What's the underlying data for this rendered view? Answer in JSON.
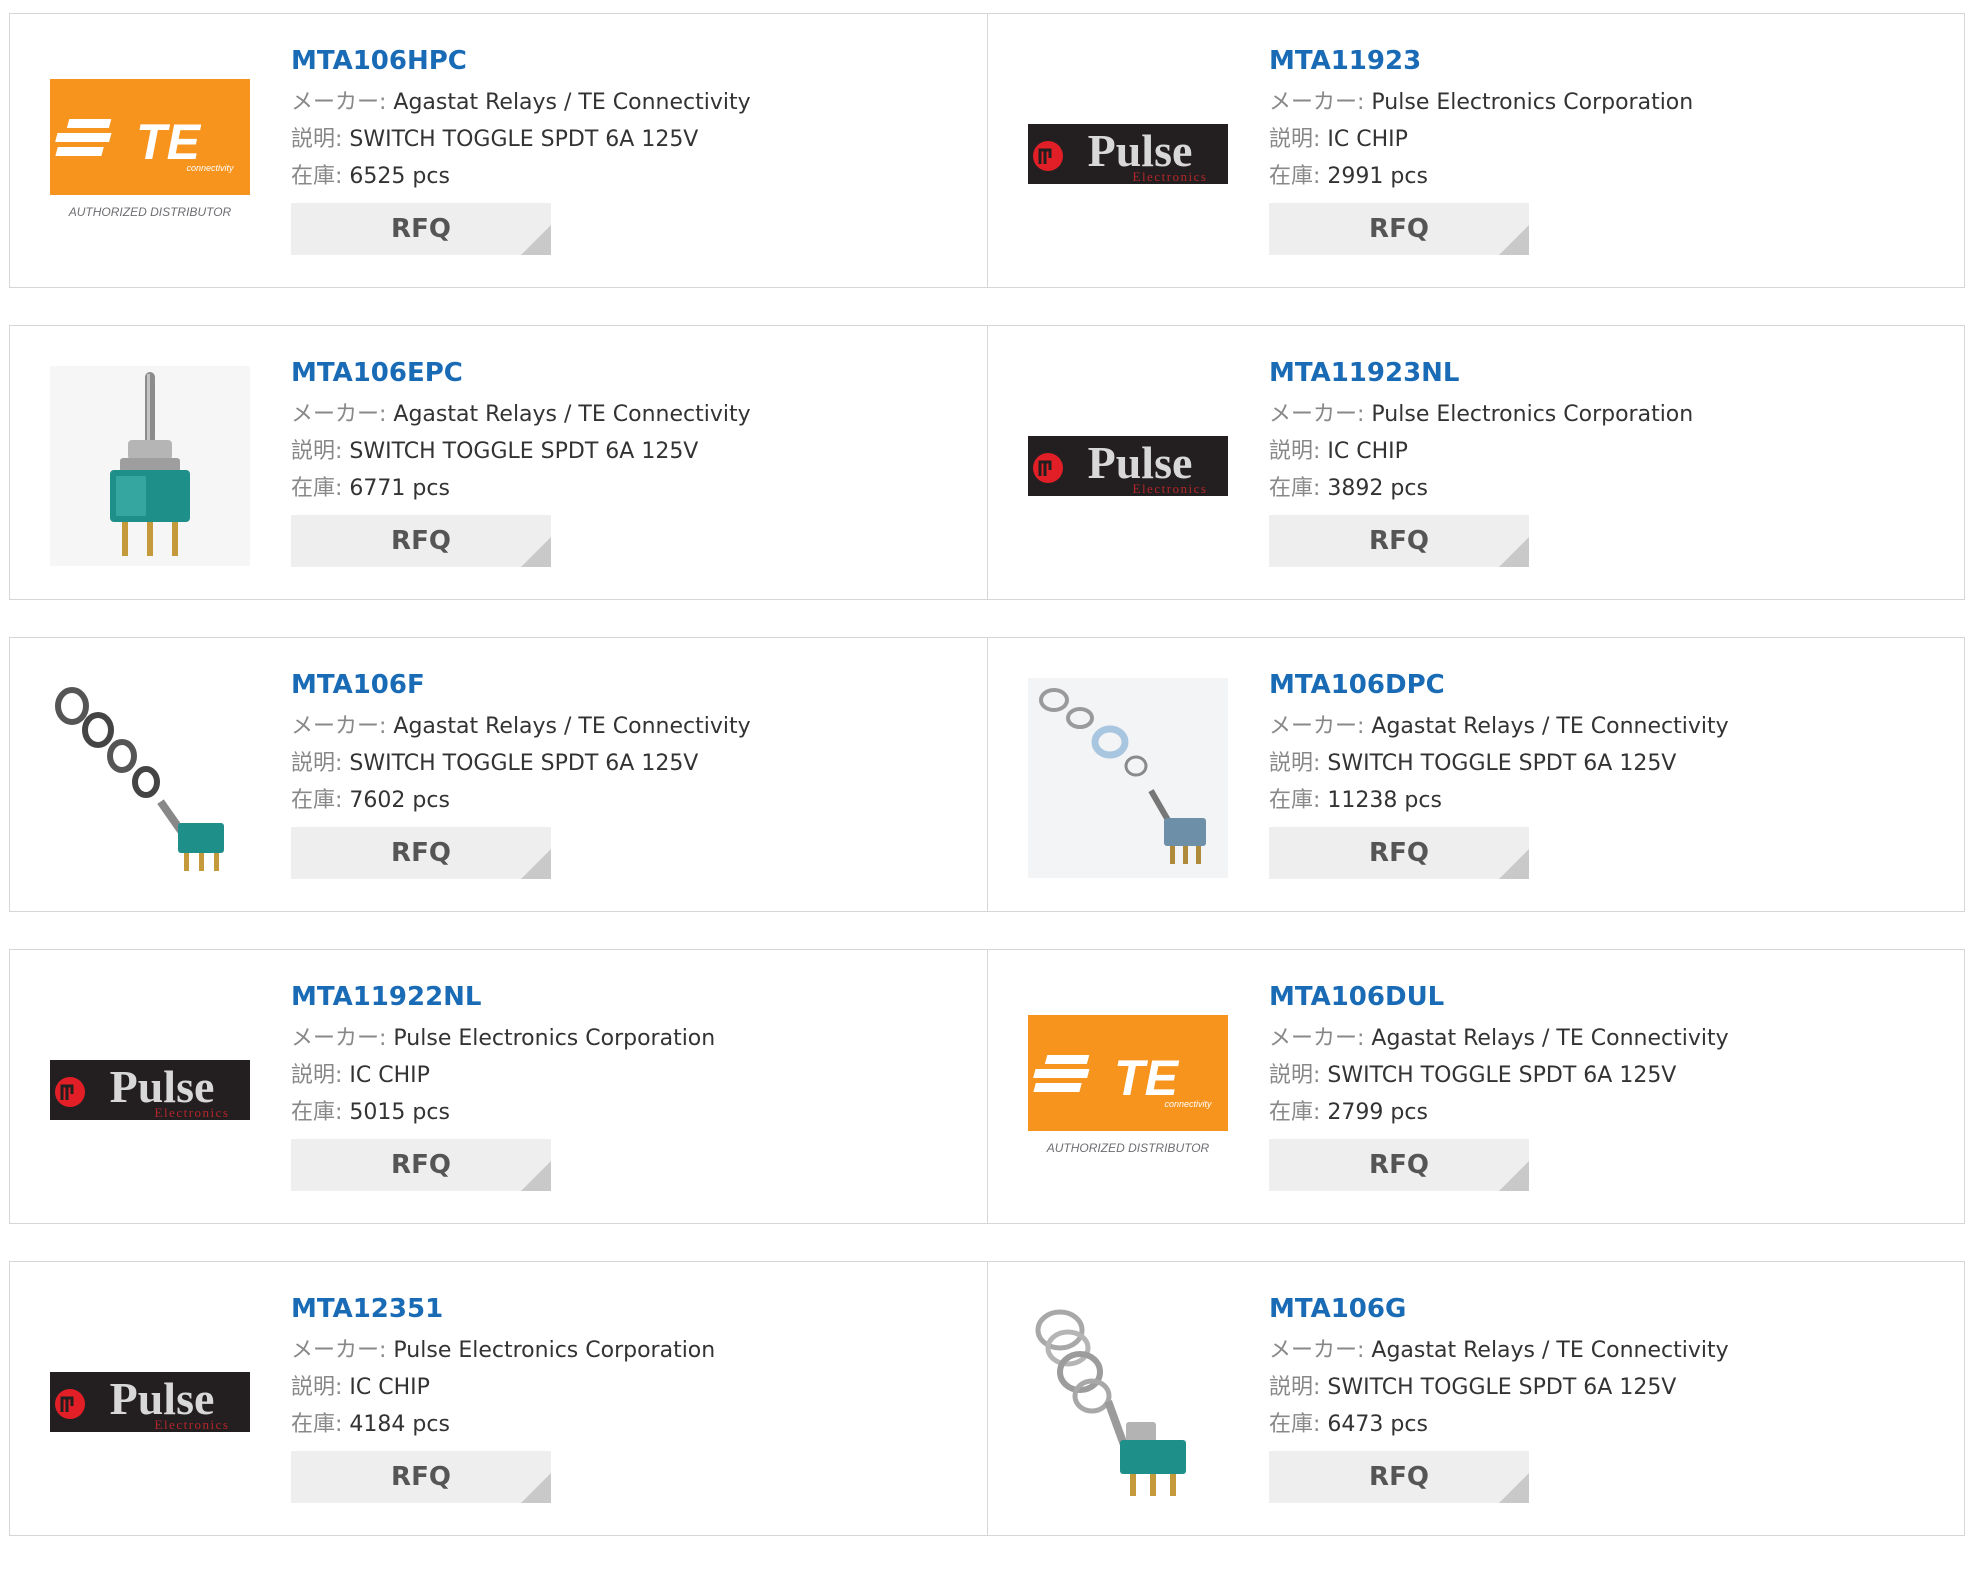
{
  "labels": {
    "manufacturer": "メーカー:",
    "description": "説明:",
    "stock": "在庫:",
    "rfq": "RFQ"
  },
  "logos": {
    "te": {
      "brand": "TE",
      "sub": "connectivity",
      "caption": "AUTHORIZED DISTRIBUTOR",
      "color": "#f7941d"
    },
    "pulse": {
      "brand": "Pulse",
      "sub": "Electronics",
      "bg": "#231f20",
      "accent": "#e21f26"
    }
  },
  "products": [
    {
      "part": "MTA106HPC",
      "manufacturer": "Agastat Relays / TE Connectivity",
      "description": "SWITCH TOGGLE SPDT 6A 125V",
      "stock": "6525 pcs",
      "image": "te-logo"
    },
    {
      "part": "MTA11923",
      "manufacturer": "Pulse Electronics Corporation",
      "description": "IC CHIP",
      "stock": "2991 pcs",
      "image": "pulse-logo"
    },
    {
      "part": "MTA106EPC",
      "manufacturer": "Agastat Relays / TE Connectivity",
      "description": "SWITCH TOGGLE SPDT 6A 125V",
      "stock": "6771 pcs",
      "image": "toggle-switch-photo"
    },
    {
      "part": "MTA11923NL",
      "manufacturer": "Pulse Electronics Corporation",
      "description": "IC CHIP",
      "stock": "3892 pcs",
      "image": "pulse-logo"
    },
    {
      "part": "MTA106F",
      "manufacturer": "Agastat Relays / TE Connectivity",
      "description": "SWITCH TOGGLE SPDT 6A 125V",
      "stock": "7602 pcs",
      "image": "toggle-switch-hardware-photo"
    },
    {
      "part": "MTA106DPC",
      "manufacturer": "Agastat Relays / TE Connectivity",
      "description": "SWITCH TOGGLE SPDT 6A 125V",
      "stock": "11238 pcs",
      "image": "toggle-switch-hardware-photo"
    },
    {
      "part": "MTA11922NL",
      "manufacturer": "Pulse Electronics Corporation",
      "description": "IC CHIP",
      "stock": "5015 pcs",
      "image": "pulse-logo"
    },
    {
      "part": "MTA106DUL",
      "manufacturer": "Agastat Relays / TE Connectivity",
      "description": "SWITCH TOGGLE SPDT 6A 125V",
      "stock": "2799 pcs",
      "image": "te-logo"
    },
    {
      "part": "MTA12351",
      "manufacturer": "Pulse Electronics Corporation",
      "description": "IC CHIP",
      "stock": "4184 pcs",
      "image": "pulse-logo"
    },
    {
      "part": "MTA106G",
      "manufacturer": "Agastat Relays / TE Connectivity",
      "description": "SWITCH TOGGLE SPDT 6A 125V",
      "stock": "6473 pcs",
      "image": "toggle-switch-hardware-photo"
    }
  ]
}
